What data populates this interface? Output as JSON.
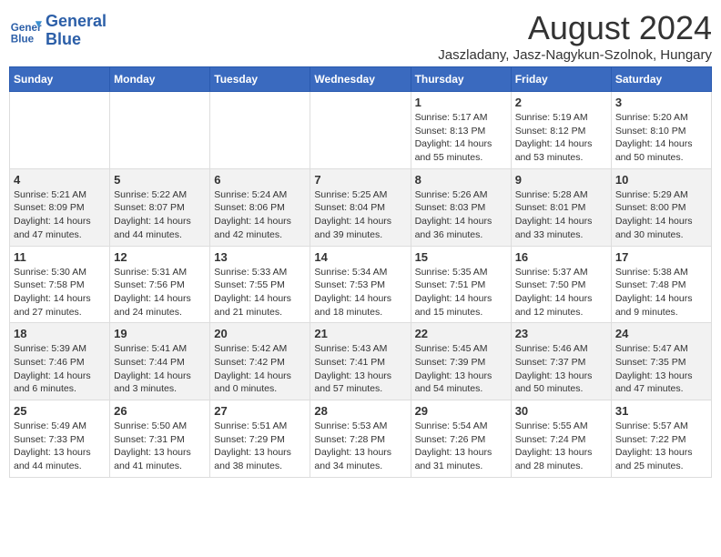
{
  "header": {
    "logo_line1": "General",
    "logo_line2": "Blue",
    "month_year": "August 2024",
    "location": "Jaszladany, Jasz-Nagykun-Szolnok, Hungary"
  },
  "days_of_week": [
    "Sunday",
    "Monday",
    "Tuesday",
    "Wednesday",
    "Thursday",
    "Friday",
    "Saturday"
  ],
  "weeks": [
    [
      {
        "day": "",
        "info": ""
      },
      {
        "day": "",
        "info": ""
      },
      {
        "day": "",
        "info": ""
      },
      {
        "day": "",
        "info": ""
      },
      {
        "day": "1",
        "info": "Sunrise: 5:17 AM\nSunset: 8:13 PM\nDaylight: 14 hours\nand 55 minutes."
      },
      {
        "day": "2",
        "info": "Sunrise: 5:19 AM\nSunset: 8:12 PM\nDaylight: 14 hours\nand 53 minutes."
      },
      {
        "day": "3",
        "info": "Sunrise: 5:20 AM\nSunset: 8:10 PM\nDaylight: 14 hours\nand 50 minutes."
      }
    ],
    [
      {
        "day": "4",
        "info": "Sunrise: 5:21 AM\nSunset: 8:09 PM\nDaylight: 14 hours\nand 47 minutes."
      },
      {
        "day": "5",
        "info": "Sunrise: 5:22 AM\nSunset: 8:07 PM\nDaylight: 14 hours\nand 44 minutes."
      },
      {
        "day": "6",
        "info": "Sunrise: 5:24 AM\nSunset: 8:06 PM\nDaylight: 14 hours\nand 42 minutes."
      },
      {
        "day": "7",
        "info": "Sunrise: 5:25 AM\nSunset: 8:04 PM\nDaylight: 14 hours\nand 39 minutes."
      },
      {
        "day": "8",
        "info": "Sunrise: 5:26 AM\nSunset: 8:03 PM\nDaylight: 14 hours\nand 36 minutes."
      },
      {
        "day": "9",
        "info": "Sunrise: 5:28 AM\nSunset: 8:01 PM\nDaylight: 14 hours\nand 33 minutes."
      },
      {
        "day": "10",
        "info": "Sunrise: 5:29 AM\nSunset: 8:00 PM\nDaylight: 14 hours\nand 30 minutes."
      }
    ],
    [
      {
        "day": "11",
        "info": "Sunrise: 5:30 AM\nSunset: 7:58 PM\nDaylight: 14 hours\nand 27 minutes."
      },
      {
        "day": "12",
        "info": "Sunrise: 5:31 AM\nSunset: 7:56 PM\nDaylight: 14 hours\nand 24 minutes."
      },
      {
        "day": "13",
        "info": "Sunrise: 5:33 AM\nSunset: 7:55 PM\nDaylight: 14 hours\nand 21 minutes."
      },
      {
        "day": "14",
        "info": "Sunrise: 5:34 AM\nSunset: 7:53 PM\nDaylight: 14 hours\nand 18 minutes."
      },
      {
        "day": "15",
        "info": "Sunrise: 5:35 AM\nSunset: 7:51 PM\nDaylight: 14 hours\nand 15 minutes."
      },
      {
        "day": "16",
        "info": "Sunrise: 5:37 AM\nSunset: 7:50 PM\nDaylight: 14 hours\nand 12 minutes."
      },
      {
        "day": "17",
        "info": "Sunrise: 5:38 AM\nSunset: 7:48 PM\nDaylight: 14 hours\nand 9 minutes."
      }
    ],
    [
      {
        "day": "18",
        "info": "Sunrise: 5:39 AM\nSunset: 7:46 PM\nDaylight: 14 hours\nand 6 minutes."
      },
      {
        "day": "19",
        "info": "Sunrise: 5:41 AM\nSunset: 7:44 PM\nDaylight: 14 hours\nand 3 minutes."
      },
      {
        "day": "20",
        "info": "Sunrise: 5:42 AM\nSunset: 7:42 PM\nDaylight: 14 hours\nand 0 minutes."
      },
      {
        "day": "21",
        "info": "Sunrise: 5:43 AM\nSunset: 7:41 PM\nDaylight: 13 hours\nand 57 minutes."
      },
      {
        "day": "22",
        "info": "Sunrise: 5:45 AM\nSunset: 7:39 PM\nDaylight: 13 hours\nand 54 minutes."
      },
      {
        "day": "23",
        "info": "Sunrise: 5:46 AM\nSunset: 7:37 PM\nDaylight: 13 hours\nand 50 minutes."
      },
      {
        "day": "24",
        "info": "Sunrise: 5:47 AM\nSunset: 7:35 PM\nDaylight: 13 hours\nand 47 minutes."
      }
    ],
    [
      {
        "day": "25",
        "info": "Sunrise: 5:49 AM\nSunset: 7:33 PM\nDaylight: 13 hours\nand 44 minutes."
      },
      {
        "day": "26",
        "info": "Sunrise: 5:50 AM\nSunset: 7:31 PM\nDaylight: 13 hours\nand 41 minutes."
      },
      {
        "day": "27",
        "info": "Sunrise: 5:51 AM\nSunset: 7:29 PM\nDaylight: 13 hours\nand 38 minutes."
      },
      {
        "day": "28",
        "info": "Sunrise: 5:53 AM\nSunset: 7:28 PM\nDaylight: 13 hours\nand 34 minutes."
      },
      {
        "day": "29",
        "info": "Sunrise: 5:54 AM\nSunset: 7:26 PM\nDaylight: 13 hours\nand 31 minutes."
      },
      {
        "day": "30",
        "info": "Sunrise: 5:55 AM\nSunset: 7:24 PM\nDaylight: 13 hours\nand 28 minutes."
      },
      {
        "day": "31",
        "info": "Sunrise: 5:57 AM\nSunset: 7:22 PM\nDaylight: 13 hours\nand 25 minutes."
      }
    ]
  ]
}
